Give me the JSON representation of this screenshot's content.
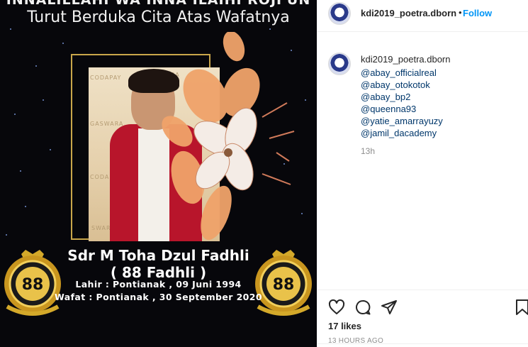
{
  "post_image": {
    "header_line1": "INNALILLAHI WA INNA ILAIHI ROJI'UN",
    "header_line2": "Turut Berduka Cita Atas Wafatnya",
    "name": "Sdr M Toha Dzul Fadhli",
    "nickname": "( 88 Fadhli )",
    "born": "Lahir : Pontianak , 09 Juni 1994",
    "died": "Wafat : Pontianak , 30 September 2020",
    "badge_label": "88",
    "badge_color": "#d4a92a"
  },
  "post_header": {
    "username": "kdi2019_poetra.dborn",
    "separator": "•",
    "follow_label": "Follow"
  },
  "comment": {
    "username": "kdi2019_poetra.dborn",
    "mentions": [
      "@abay_officialreal",
      "@abay_otokotok",
      "@abay_bp2",
      "@queenna93",
      "@yatie_amarrayuzy",
      "@jamil_dacademy"
    ],
    "time": "13h"
  },
  "actions": {
    "icons": [
      "heart-icon",
      "comment-icon",
      "share-icon",
      "bookmark-icon"
    ]
  },
  "likes": "17 likes",
  "post_time": "13 HOURS AGO",
  "colors": {
    "link": "#00376b",
    "follow": "#0095f6",
    "muted": "#8e8e8e"
  }
}
